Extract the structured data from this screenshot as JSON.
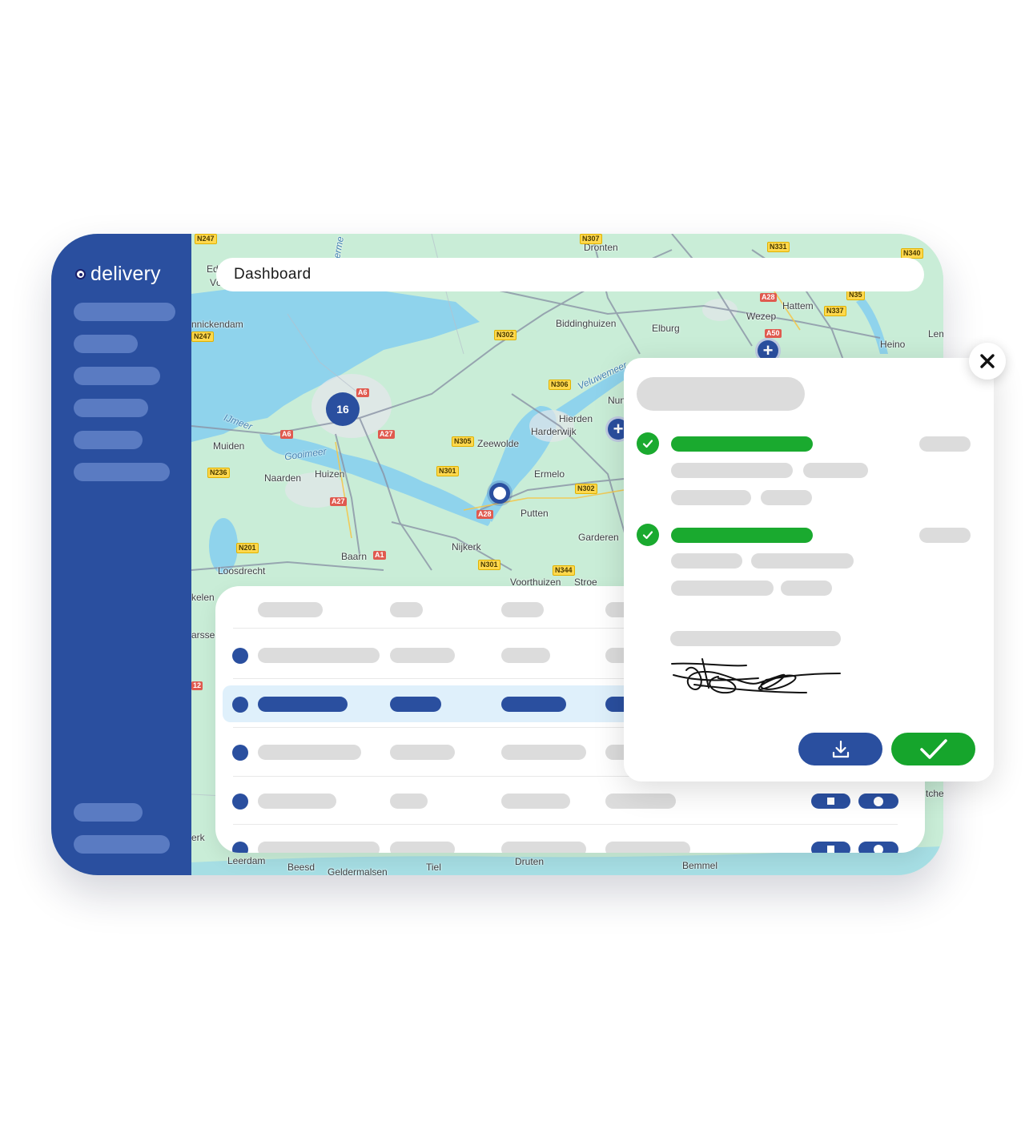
{
  "app": {
    "brand": "delivery",
    "page_title": "Dashboard",
    "colors": {
      "primary": "#2a4f9f",
      "success": "#16a52c",
      "highlight_row": "#dff0fb",
      "placeholder": "#dcdcdc"
    }
  },
  "map": {
    "cluster_count": "16",
    "labels": {
      "dronten": "Dronten",
      "hattem": "Hattem",
      "wezep": "Wezep",
      "heino": "Heino",
      "lem": "Lem",
      "elburg": "Elburg",
      "biddinghuizen": "Biddinghuizen",
      "veluwemeer": "Veluwemeer",
      "nun": "Nun",
      "hierden": "Hierden",
      "harderwijk": "Harderwijk",
      "zeewolde": "Zeewolde",
      "ermelo": "Ermelo",
      "putten": "Putten",
      "garderen": "Garderen",
      "nijkerk": "Nijkerk",
      "voorthuizen": "Voorthuizen",
      "stroe": "Stroe",
      "muiden": "Muiden",
      "gooimeer": "Gooimeer",
      "ijmeer": "IJmeer",
      "naarden": "Naarden",
      "huizen": "Huizen",
      "baarn": "Baarn",
      "loosdrecht": "Loosdrecht",
      "leerdam": "Leerdam",
      "beesd": "Beesd",
      "geldermalsen": "Geldermalsen",
      "tiel": "Tiel",
      "druten": "Druten",
      "bemmel": "Bemmel",
      "nickendam": "nnickendam",
      "ed": "Ed",
      "vc": "Vc",
      "kelen": "kelen",
      "arsse": "arsse",
      "erk": "erk",
      "tche": "tche",
      "ermeer_top": "erme"
    },
    "shields": {
      "n247_top": "N247",
      "n247": "N247",
      "n307": "N307",
      "n331": "N331",
      "n340": "N340",
      "n302_top": "N302",
      "a28_top": "A28",
      "n35": "N35",
      "n337": "N337",
      "a50": "A50",
      "a6": "A6",
      "a6_b": "A6",
      "a27": "A27",
      "n306": "N306",
      "n305": "N305",
      "n301": "N301",
      "n302": "N302",
      "n236": "N236",
      "a27_b": "A27",
      "a28": "A28",
      "n201": "N201",
      "a1": "A1",
      "n301_b": "N301",
      "n344": "N344",
      "n12": "12"
    }
  }
}
